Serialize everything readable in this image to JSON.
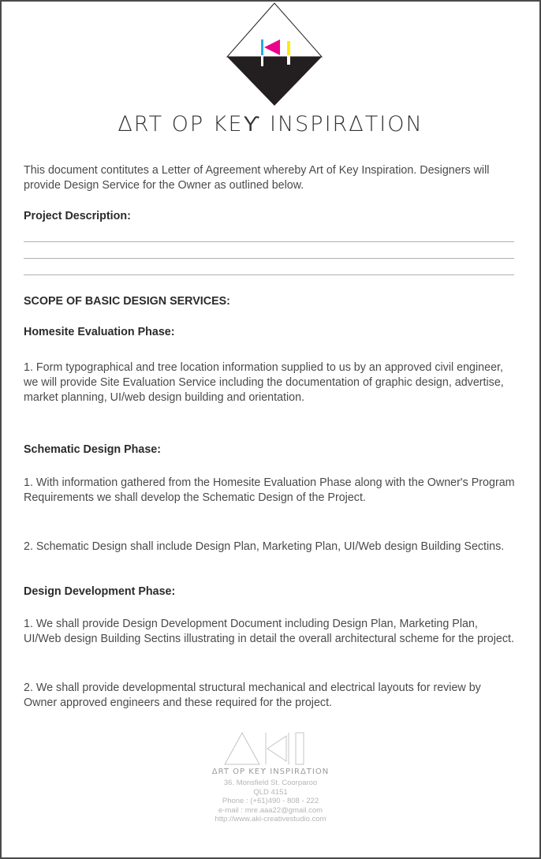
{
  "brand": {
    "name": "Art of Key Inspiration",
    "name_display": "ΔRT OP KEϒ INSPIRΔTION",
    "footer_name_display": "ΔRT OP KEϒ INSPIRΔTION",
    "colors": {
      "cyan": "#29abe2",
      "magenta": "#ec008c",
      "yellow": "#ffed00",
      "dark": "#231f20"
    }
  },
  "intro": "This document contitutes a Letter of Agreement whereby Art of Key Inspiration. Designers will provide Design Service for the Owner as outlined below.",
  "project_description": {
    "label": "Project Description:"
  },
  "scope": {
    "title": "SCOPE OF BASIC DESIGN SERVICES:",
    "homesite": {
      "title": "Homesite Evaluation Phase:",
      "p1": "1. Form typographical and tree location information supplied to us by an approved civil engineer, we will provide Site Evaluation Service including the documentation of graphic design, advertise, market planning, UI/web design building and orientation."
    },
    "schematic": {
      "title": "Schematic Design Phase:",
      "p1": "1. With information gathered from the Homesite Evaluation Phase along with the Owner's Program Requirements we shall develop the Schematic Design of the Project.",
      "p2": "2. Schematic Design shall include Design Plan, Marketing Plan, UI/Web design Building Sectins."
    },
    "development": {
      "title": "Design Development Phase:",
      "p1": "1. We shall provide Design Development Document including Design Plan, Marketing Plan, UI/Web design Building Sectins illustrating in detail the overall architectural scheme for the project.",
      "p2": "2. We shall provide developmental structural mechanical and electrical layouts for review by Owner approved engineers and these required for the project."
    }
  },
  "footer": {
    "address1": "36. Monsfield St. Coorparoo",
    "address2": "QLD 4151",
    "phone": "Phone : (+61)490 - 808 - 222",
    "email": "e-mail : mre.aaa22@gmail.com",
    "website": "http://www.aki-creativestudio.com"
  }
}
